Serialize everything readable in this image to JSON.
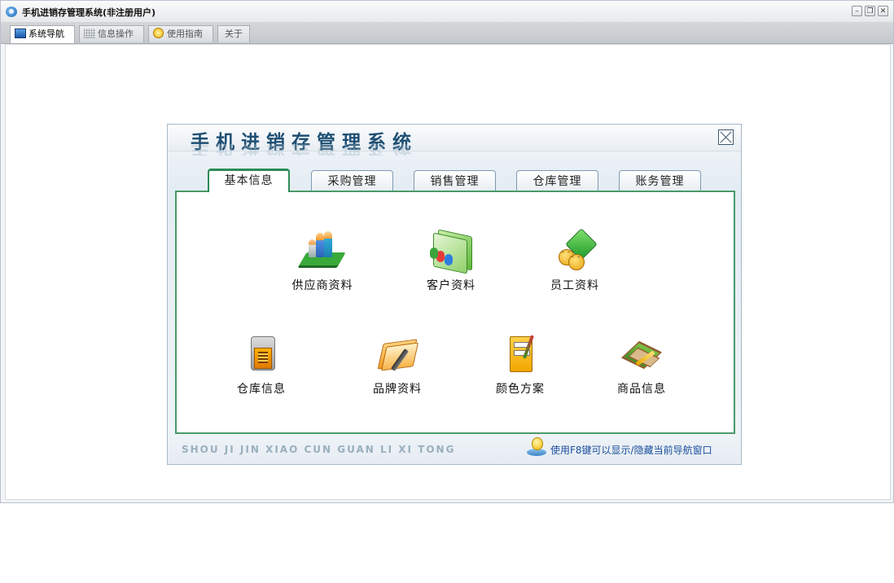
{
  "window": {
    "title": "手机进销存管理系统(非注册用户)",
    "controls": [
      "minimize",
      "restore",
      "close"
    ]
  },
  "top_tabs": [
    {
      "label": "系统导航",
      "icon": "monitor-icon",
      "active": true
    },
    {
      "label": "信息操作",
      "icon": "grid-icon",
      "active": false
    },
    {
      "label": "使用指南",
      "icon": "guide-icon",
      "active": false
    },
    {
      "label": "关于",
      "icon": "",
      "active": false
    }
  ],
  "nav": {
    "title": "手机进销存管理系统",
    "tabs": [
      {
        "label": "基本信息",
        "active": true
      },
      {
        "label": "采购管理",
        "active": false
      },
      {
        "label": "销售管理",
        "active": false
      },
      {
        "label": "仓库管理",
        "active": false
      },
      {
        "label": "账务管理",
        "active": false
      }
    ],
    "items": [
      {
        "label": "供应商资料",
        "icon": "supplier-icon"
      },
      {
        "label": "客户资料",
        "icon": "customer-icon"
      },
      {
        "label": "员工资料",
        "icon": "staff-icon"
      },
      {
        "label": "仓库信息",
        "icon": "warehouse-icon"
      },
      {
        "label": "品牌资料",
        "icon": "brand-folder-icon"
      },
      {
        "label": "颜色方案",
        "icon": "color-scheme-icon"
      },
      {
        "label": "商品信息",
        "icon": "goods-icon"
      }
    ],
    "pinyin": "SHOU JI JIN XIAO CUN GUAN LI XI TONG",
    "hint": "使用F8键可以显示/隐藏当前导航窗口"
  },
  "colors": {
    "active_tab_border": "#2d8b56",
    "hint_text": "#1b4e9c",
    "title_text": "#1f4f73"
  }
}
